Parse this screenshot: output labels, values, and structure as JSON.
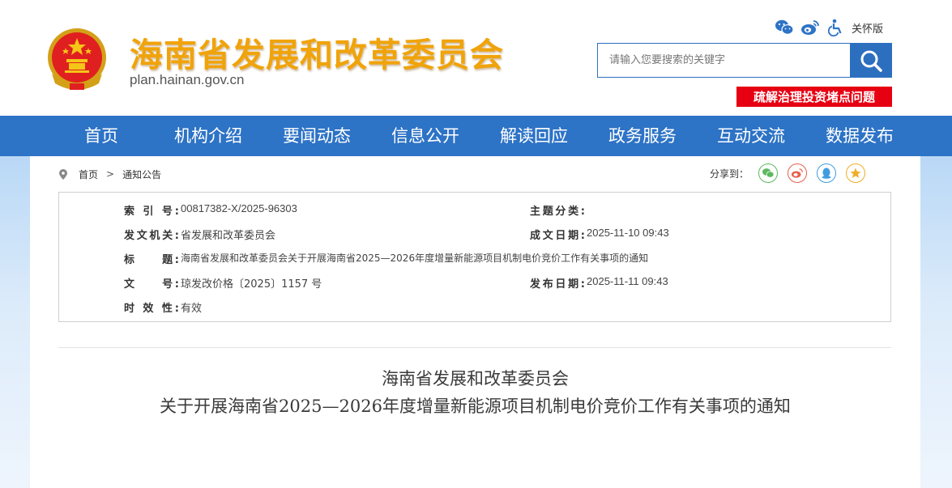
{
  "header": {
    "site_title": "海南省发展和改革委员会",
    "site_url": "plan.hainan.gov.cn",
    "care_version": "关怀版",
    "icons": [
      "wechat-icon",
      "weibo-icon",
      "accessibility-icon"
    ],
    "search_placeholder": "请输入您要搜索的关键字",
    "promo_banner": "疏解治理投资堵点问题"
  },
  "nav": {
    "items": [
      "首页",
      "机构介绍",
      "要闻动态",
      "信息公开",
      "解读回应",
      "政务服务",
      "互动交流",
      "数据发布"
    ]
  },
  "breadcrumb": {
    "home": "首页",
    "separator": ">",
    "current": "通知公告"
  },
  "share": {
    "label": "分享到：",
    "targets": [
      "wechat-icon",
      "weibo-icon",
      "qq-icon",
      "qzone-icon"
    ]
  },
  "info": {
    "index_label": "索 引 号:",
    "index_value": "00817382-X/2025-96303",
    "topic_label": "主题分类:",
    "topic_value": "",
    "issuer_label": "发文机关:",
    "issuer_value": "省发展和改革委员会",
    "created_label": "成文日期:",
    "created_value": "2025-11-10 09:43",
    "title_label": "标　　题:",
    "title_value": "海南省发展和改革委员会关于开展海南省2025—2026年度增量新能源项目机制电价竞价工作有关事项的通知",
    "docno_label": "文　　号:",
    "docno_value": "琼发改价格〔2025〕1157 号",
    "published_label": "发布日期:",
    "published_value": "2025-11-11 09:43",
    "validity_label": "时 效 性:",
    "validity_value": "有效"
  },
  "document": {
    "title_line1": "海南省发展和改革委员会",
    "title_line2": "关于开展海南省2025—2026年度增量新能源项目机制电价竞价工作有关事项的通知"
  },
  "colors": {
    "brand_blue": "#2d73c6",
    "title_gold": "#f0a30a",
    "promo_red": "#e60012"
  }
}
